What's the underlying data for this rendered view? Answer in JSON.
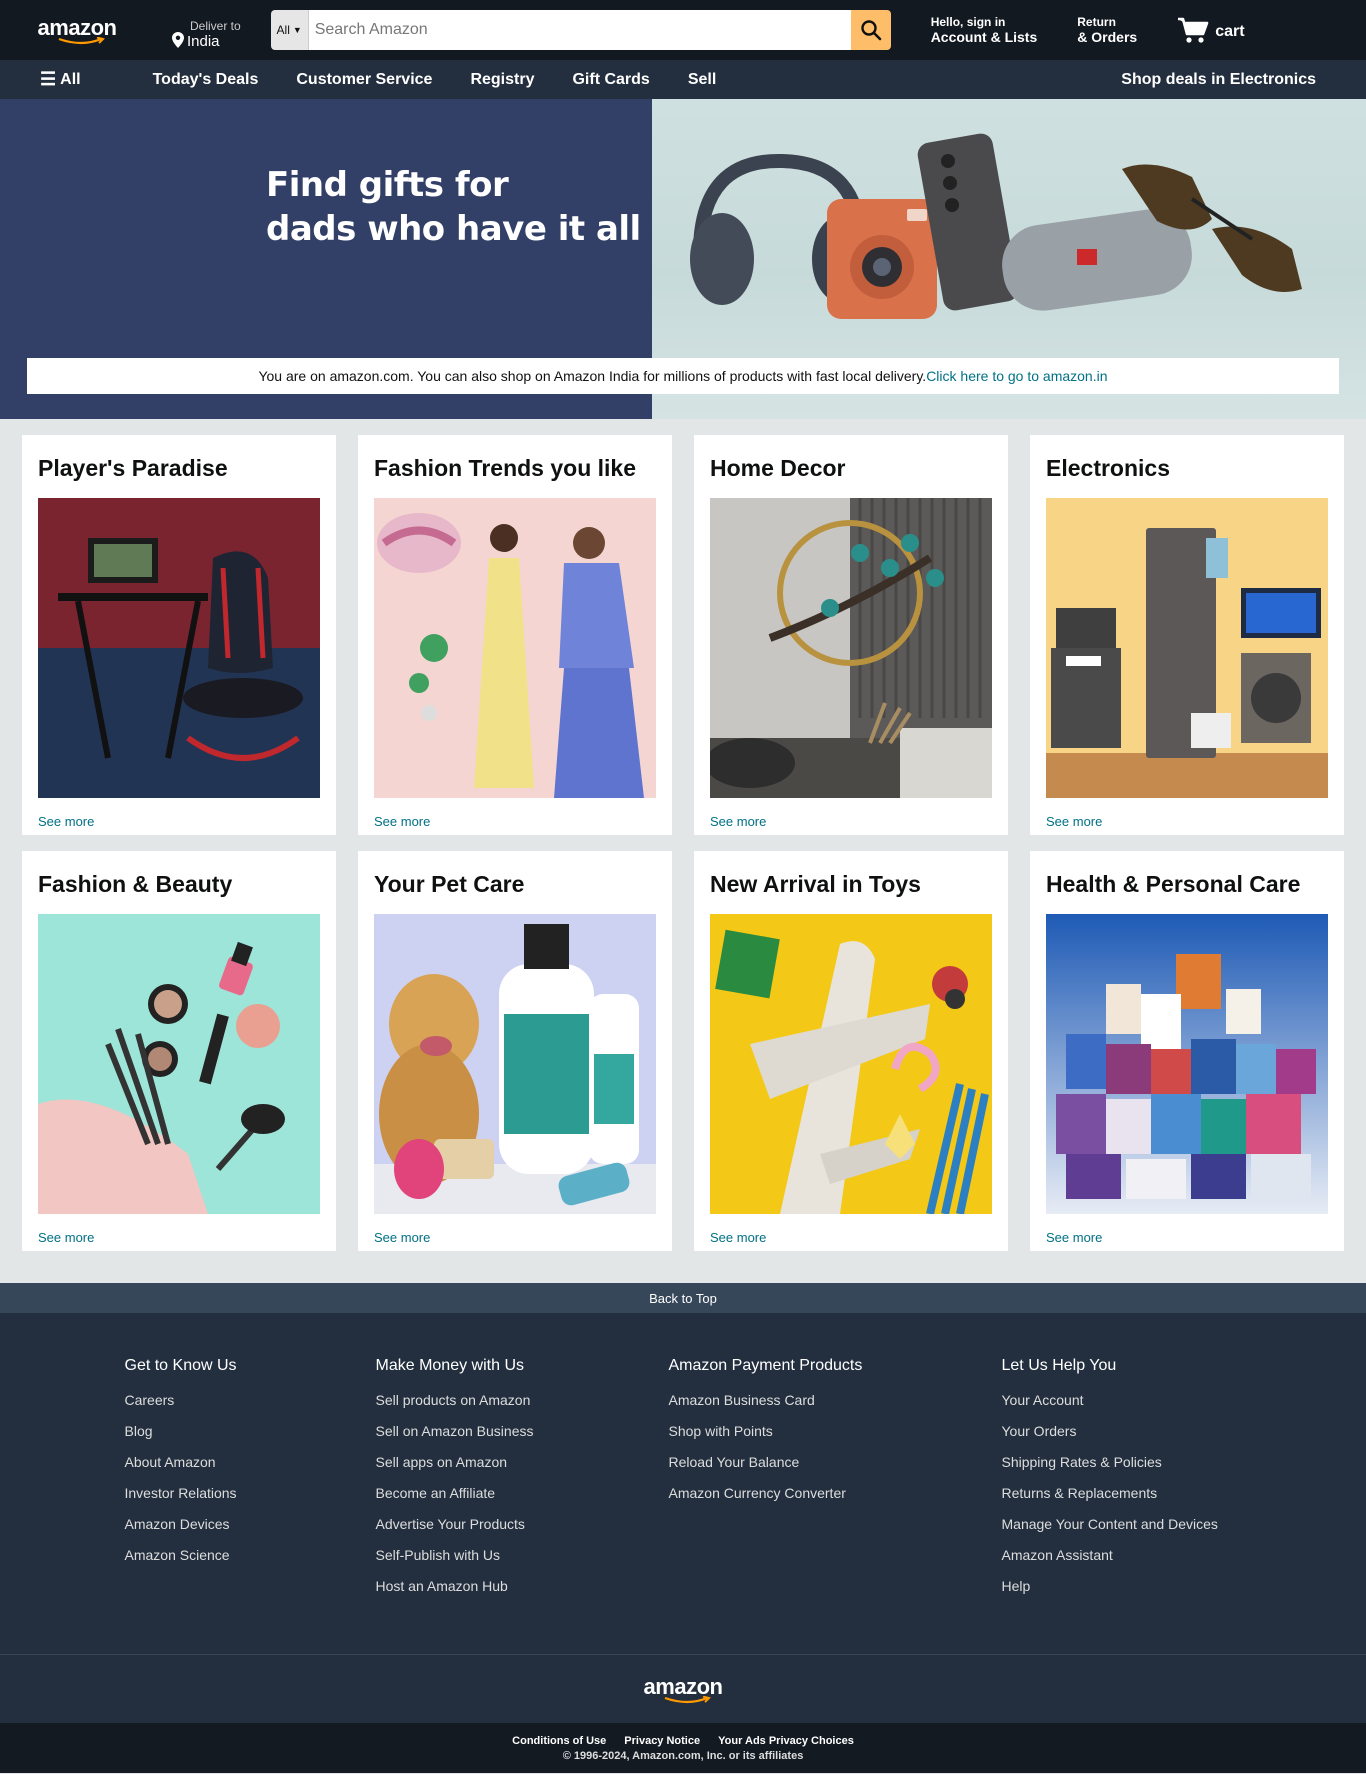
{
  "header": {
    "logo_text": "amazon",
    "deliver_line1": "Deliver to",
    "deliver_line2": "India",
    "search_category": "All",
    "search_placeholder": "Search Amazon",
    "account_line1": "Hello, sign in",
    "account_line2": "Account & Lists",
    "orders_line1": "Return",
    "orders_line2": "& Orders",
    "cart_label": "cart",
    "accent_color": "#febd69"
  },
  "nav": {
    "all_label": "All",
    "links": [
      "Today's Deals",
      "Customer Service",
      "Registry",
      "Gift Cards",
      "Sell"
    ],
    "right_link": "Shop deals in Electronics"
  },
  "hero": {
    "title_line1": "Find gifts for",
    "title_line2": "dads who have it all",
    "banner_text": "You are on amazon.com. You can also shop on Amazon India for millions of products with fast local delivery.",
    "banner_link": "Click here to go to amazon.in"
  },
  "cards": [
    {
      "title": "Player's Paradise",
      "see_more": "See more",
      "image": "gaming-chair-setup"
    },
    {
      "title": "Fashion Trends you like",
      "see_more": "See more",
      "image": "fashion-models"
    },
    {
      "title": "Home Decor",
      "see_more": "See more",
      "image": "wall-decor-living-room"
    },
    {
      "title": "Electronics",
      "see_more": "See more",
      "image": "home-appliances"
    },
    {
      "title": "Fashion & Beauty",
      "see_more": "See more",
      "image": "makeup-bag"
    },
    {
      "title": "Your Pet Care",
      "see_more": "See more",
      "image": "dog-shampoo"
    },
    {
      "title": "New Arrival in Toys",
      "see_more": "See more",
      "image": "toy-airplane"
    },
    {
      "title": "Health & Personal Care",
      "see_more": "See more",
      "image": "health-products"
    }
  ],
  "footer": {
    "back_to_top": "Back to Top",
    "columns": [
      {
        "heading": "Get to Know Us",
        "links": [
          "Careers",
          "Blog",
          "About Amazon",
          "Investor Relations",
          "Amazon Devices",
          "Amazon Science"
        ]
      },
      {
        "heading": "Make Money with Us",
        "links": [
          "Sell products on Amazon",
          "Sell on Amazon Business",
          "Sell apps on Amazon",
          "Become an Affiliate",
          "Advertise Your Products",
          "Self-Publish with Us",
          "Host an Amazon Hub"
        ]
      },
      {
        "heading": "Amazon Payment Products",
        "links": [
          "Amazon Business Card",
          "Shop with Points",
          "Reload Your Balance",
          "Amazon Currency Converter"
        ]
      },
      {
        "heading": "Let Us Help You",
        "links": [
          "Your Account",
          "Your Orders",
          "Shipping Rates & Policies",
          "Returns & Replacements",
          "Manage Your Content and Devices",
          "Amazon Assistant",
          "Help"
        ]
      }
    ],
    "logo_text": "amazon",
    "bottom_links": [
      "Conditions of Use",
      "Privacy Notice",
      "Your Ads Privacy Choices"
    ],
    "copyright": "© 1996-2024, Amazon.com, Inc. or its affiliates"
  }
}
